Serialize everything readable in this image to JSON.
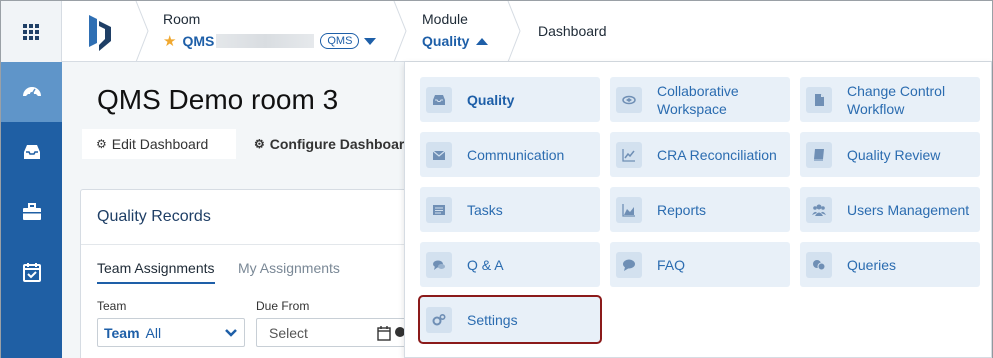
{
  "header": {
    "room_label": "Room",
    "room_name": "QMS",
    "room_badge": "QMS",
    "module_label": "Module",
    "module_name": "Quality",
    "current_page": "Dashboard"
  },
  "leftnav": {
    "items": [
      {
        "icon": "dashboard-gauge-icon",
        "active": true
      },
      {
        "icon": "inbox-icon",
        "active": false
      },
      {
        "icon": "briefcase-icon",
        "active": false
      },
      {
        "icon": "calendar-check-icon",
        "active": false
      }
    ]
  },
  "main": {
    "room_title": "QMS Demo room 3",
    "edit_dashboard": "Edit Dashboard",
    "configure_dashboard": "Configure Dashboard",
    "card": {
      "title": "Quality Records",
      "tab_team": "Team Assignments",
      "tab_my": "My Assignments",
      "team_label": "Team",
      "team_value_bold": "Team",
      "team_value": "All",
      "due_label": "Due From",
      "due_placeholder": "Select"
    }
  },
  "modules": [
    {
      "label": "Quality",
      "icon": "inbox-icon"
    },
    {
      "label": "Collaborative Workspace",
      "icon": "handshake-icon"
    },
    {
      "label": "Change Control Workflow",
      "icon": "document-icon"
    },
    {
      "label": "Communication",
      "icon": "envelope-icon"
    },
    {
      "label": "CRA Reconciliation",
      "icon": "line-chart-icon"
    },
    {
      "label": "Quality Review",
      "icon": "book-icon"
    },
    {
      "label": "Tasks",
      "icon": "task-list-icon"
    },
    {
      "label": "Reports",
      "icon": "area-chart-icon"
    },
    {
      "label": "Users Management",
      "icon": "users-icon"
    },
    {
      "label": "Q & A",
      "icon": "comments-icon"
    },
    {
      "label": "FAQ",
      "icon": "comment-icon"
    },
    {
      "label": "Queries",
      "icon": "chat-bubbles-icon"
    },
    {
      "label": "Settings",
      "icon": "cogs-icon"
    }
  ],
  "colors": {
    "accent": "#1e5fa8",
    "nav_bg": "#1f5fa4",
    "nav_active": "#5f95c9",
    "tile_bg": "#e8f0f8",
    "selected_outline": "#8b1a1a"
  }
}
